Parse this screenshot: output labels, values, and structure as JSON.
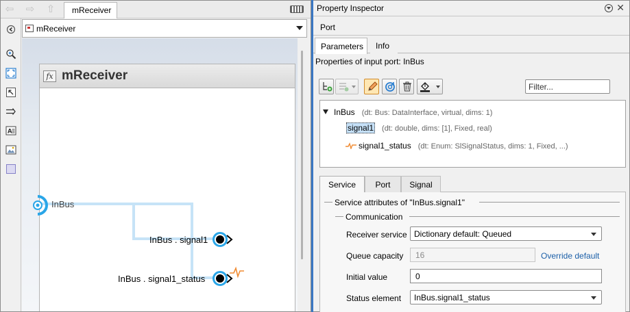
{
  "editor": {
    "tab_label": "mReceiver",
    "address": "mReceiver",
    "subsystem_title": "mReceiver",
    "fx_label": "fx",
    "ports": {
      "inport_label": "InBus",
      "signal1_label": "InBus . signal1",
      "status_label": "InBus . signal1_status"
    }
  },
  "inspector": {
    "title": "Property Inspector",
    "object_type": "Port",
    "tabs": [
      {
        "label": "Parameters",
        "active": true
      },
      {
        "label": "Info",
        "active": false
      }
    ],
    "description": "Properties of input port: InBus",
    "filter_placeholder": "Filter...",
    "tree": {
      "root": {
        "name": "InBus",
        "meta": "(dt: Bus: DataInterface, virtual, dims: 1)"
      },
      "children": [
        {
          "name": "signal1",
          "meta": "(dt: double, dims: [1], Fixed, real)",
          "selected": true
        },
        {
          "name": "signal1_status",
          "meta": "(dt: Enum: SlSignalStatus, dims: 1, Fixed, ...)",
          "selected": false
        }
      ]
    },
    "service_tabs": [
      {
        "label": "Service",
        "active": true
      },
      {
        "label": "Port",
        "active": false
      },
      {
        "label": "Signal",
        "active": false
      }
    ],
    "service": {
      "group_title": "Service attributes of \"InBus.signal1\"",
      "subgroup_title": "Communication",
      "receiver_service": {
        "label": "Receiver service",
        "value": "Dictionary default: Queued"
      },
      "queue_capacity": {
        "label": "Queue capacity",
        "value": "16",
        "link": "Override default"
      },
      "initial_value": {
        "label": "Initial value",
        "value": "0"
      },
      "status_element": {
        "label": "Status element",
        "value": "InBus.signal1_status"
      }
    }
  },
  "colors": {
    "accent": "#3a78c4",
    "port_blue": "#2aa6e8",
    "wire": "#c6e3f7",
    "status_signal": "#f08c34",
    "link": "#1b5fa8"
  }
}
